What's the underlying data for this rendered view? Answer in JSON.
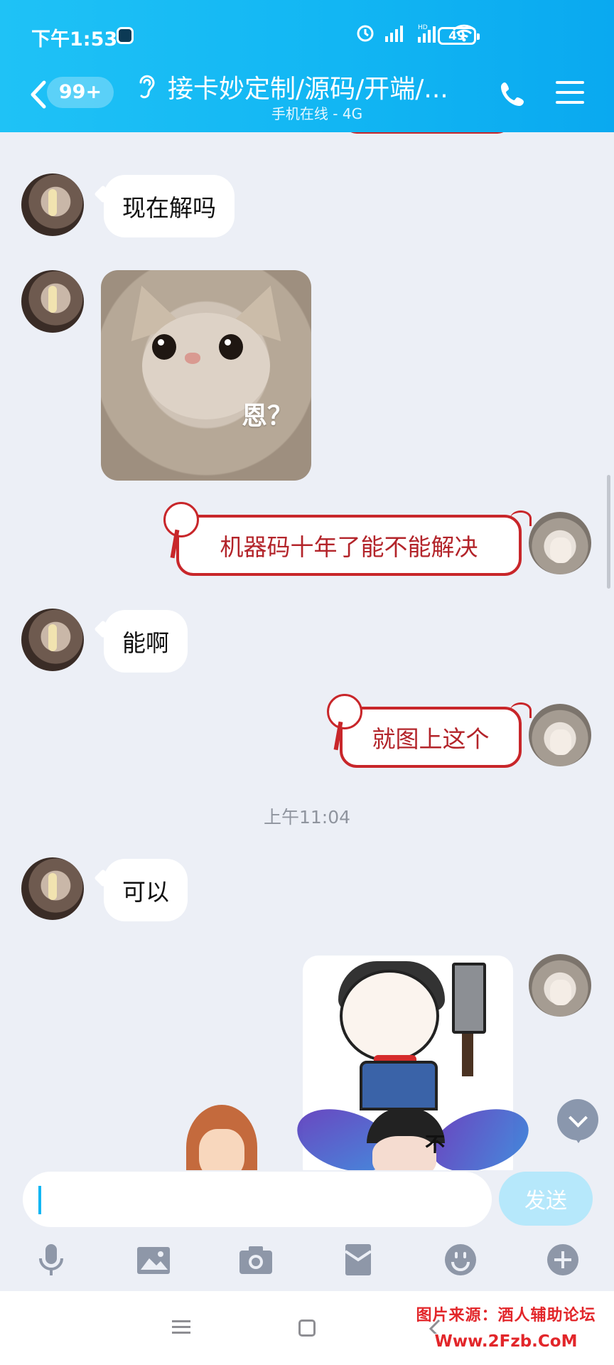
{
  "status_bar": {
    "time": "下午1:53",
    "battery": "49"
  },
  "header": {
    "unread_badge": "99+",
    "title": "接卡妙定制/源码/开端/...",
    "subtitle": "手机在线 - 4G"
  },
  "messages": [
    {
      "side": "in",
      "type": "text",
      "text": "现在解吗"
    },
    {
      "side": "in",
      "type": "image",
      "caption": "恩？"
    },
    {
      "side": "out",
      "type": "text",
      "text": "机器码十年了能不能解决"
    },
    {
      "side": "in",
      "type": "text",
      "text": "能啊"
    },
    {
      "side": "out",
      "type": "text",
      "text": "就图上这个"
    },
    {
      "side": "system",
      "type": "timestamp",
      "text": "上午11:04"
    },
    {
      "side": "in",
      "type": "text",
      "text": "可以"
    },
    {
      "side": "out",
      "type": "image",
      "caption": "不"
    }
  ],
  "input": {
    "placeholder": "",
    "send_label": "发送"
  },
  "toolbar_icons": [
    "microphone-icon",
    "image-icon",
    "camera-icon",
    "red-packet-icon",
    "emoji-icon",
    "plus-icon"
  ],
  "watermark": {
    "line1": "图片来源：酒人辅助论坛",
    "line2": "Www.2Fzb.CoM"
  },
  "colors": {
    "header": "#12b6f3",
    "send_button": "#b6e8fb",
    "out_bubble_border": "#c8262a",
    "out_text": "#b3242a"
  }
}
